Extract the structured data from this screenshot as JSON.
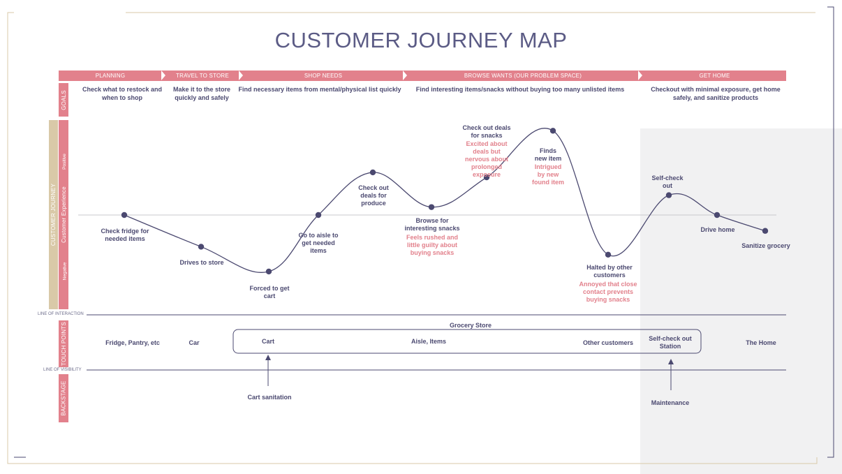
{
  "title": "CUSTOMER JOURNEY MAP",
  "colors": {
    "accent": "#e2818c",
    "ink": "#4b4970",
    "beige": "#d9c9a8",
    "highlight": "#f1f1f2"
  },
  "phases": [
    {
      "label": "PLANNING"
    },
    {
      "label": "TRAVEL TO STORE"
    },
    {
      "label": "SHOP NEEDS"
    },
    {
      "label": "BROWSE WANTS (OUR PROBLEM SPACE)"
    },
    {
      "label": "GET HOME"
    }
  ],
  "rows": {
    "goals": "GOALS",
    "customer_journey": "CUSTOMER JOURNEY",
    "positive": "Positive",
    "customer_experience": "Customer Experience",
    "negative": "Negative",
    "touch_points": "TOUCH POINTS",
    "backstage": "BACKSTAGE"
  },
  "goals": [
    "Check what to restock and when to shop",
    "Make it to the store quickly and safely",
    "Find necessary items from mental/physical list quickly",
    "Find interesting items/snacks without buying too many unlisted items",
    "Checkout with minimal exposure, get home safely, and sanitize products"
  ],
  "journey_points": [
    {
      "label": "Check fridge for needed items",
      "sentiment": 0
    },
    {
      "label": "Drives to store",
      "sentiment": -0.32
    },
    {
      "label": "Forced to get cart",
      "sentiment": -0.57
    },
    {
      "label": "Go to aisle to get needed items",
      "sentiment": 0
    },
    {
      "label": "Check out deals for produce",
      "sentiment": 0.43
    },
    {
      "label": "Browse for interesting snacks",
      "sentiment": 0.08,
      "emotion": "Feels rushed and little guilty about buying snacks"
    },
    {
      "label": "Check out deals for snacks",
      "sentiment": 0.38,
      "emotion": "Excited about deals but nervous about prolonged exposure"
    },
    {
      "label": "Finds new item",
      "sentiment": 0.85,
      "emotion": "Intrigued by new found item"
    },
    {
      "label": "Halted by other customers",
      "sentiment": -0.4,
      "emotion": "Annoyed that close contact prevents buying snacks"
    },
    {
      "label": "Self-check out",
      "sentiment": 0.2
    },
    {
      "label": "Drive home",
      "sentiment": 0
    },
    {
      "label": "Sanitize grocery",
      "sentiment": -0.16
    }
  ],
  "lines": {
    "interaction": "LINE OF INTERACTION",
    "visibility": "LINE OF VISIBILITY"
  },
  "touch_points": {
    "group_label": "Grocery Store",
    "items": [
      "Fridge, Pantry, etc",
      "Car",
      "Cart",
      "Aisle, Items",
      "Other customers",
      "Self-check out Station",
      "The Home"
    ]
  },
  "backstage": [
    "Cart sanitation",
    "Maintenance"
  ]
}
